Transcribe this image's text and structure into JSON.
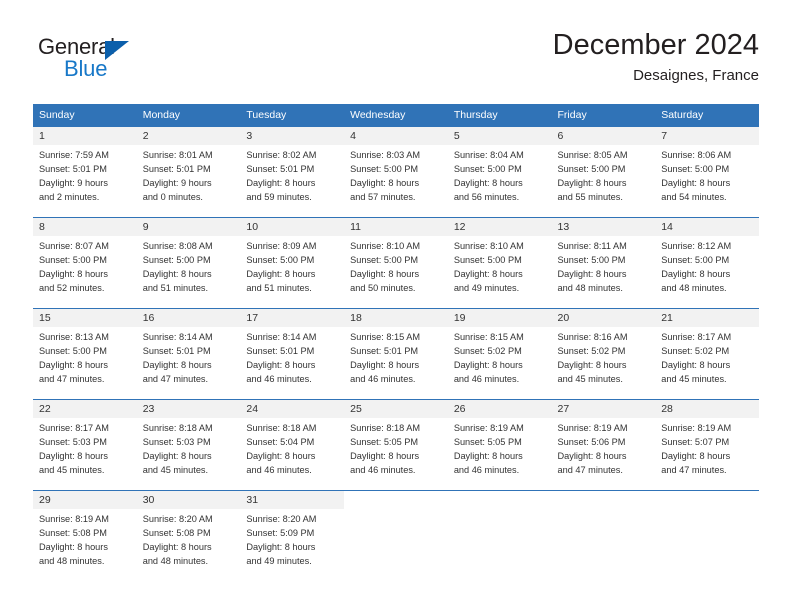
{
  "brand": {
    "name_part1": "General",
    "name_part2": "Blue",
    "accent_color": "#1878c8",
    "triangle_color": "#0b5fab"
  },
  "header": {
    "title": "December 2024",
    "subtitle": "Desaignes, France"
  },
  "calendar": {
    "header_color": "#3073b7",
    "daynum_background": "#f2f2f2",
    "weekday_headers": [
      "Sunday",
      "Monday",
      "Tuesday",
      "Wednesday",
      "Thursday",
      "Friday",
      "Saturday"
    ],
    "weeks": [
      [
        {
          "day": "1",
          "sunrise": "Sunrise: 7:59 AM",
          "sunset": "Sunset: 5:01 PM",
          "daylight_line1": "Daylight: 9 hours",
          "daylight_line2": "and 2 minutes."
        },
        {
          "day": "2",
          "sunrise": "Sunrise: 8:01 AM",
          "sunset": "Sunset: 5:01 PM",
          "daylight_line1": "Daylight: 9 hours",
          "daylight_line2": "and 0 minutes."
        },
        {
          "day": "3",
          "sunrise": "Sunrise: 8:02 AM",
          "sunset": "Sunset: 5:01 PM",
          "daylight_line1": "Daylight: 8 hours",
          "daylight_line2": "and 59 minutes."
        },
        {
          "day": "4",
          "sunrise": "Sunrise: 8:03 AM",
          "sunset": "Sunset: 5:00 PM",
          "daylight_line1": "Daylight: 8 hours",
          "daylight_line2": "and 57 minutes."
        },
        {
          "day": "5",
          "sunrise": "Sunrise: 8:04 AM",
          "sunset": "Sunset: 5:00 PM",
          "daylight_line1": "Daylight: 8 hours",
          "daylight_line2": "and 56 minutes."
        },
        {
          "day": "6",
          "sunrise": "Sunrise: 8:05 AM",
          "sunset": "Sunset: 5:00 PM",
          "daylight_line1": "Daylight: 8 hours",
          "daylight_line2": "and 55 minutes."
        },
        {
          "day": "7",
          "sunrise": "Sunrise: 8:06 AM",
          "sunset": "Sunset: 5:00 PM",
          "daylight_line1": "Daylight: 8 hours",
          "daylight_line2": "and 54 minutes."
        }
      ],
      [
        {
          "day": "8",
          "sunrise": "Sunrise: 8:07 AM",
          "sunset": "Sunset: 5:00 PM",
          "daylight_line1": "Daylight: 8 hours",
          "daylight_line2": "and 52 minutes."
        },
        {
          "day": "9",
          "sunrise": "Sunrise: 8:08 AM",
          "sunset": "Sunset: 5:00 PM",
          "daylight_line1": "Daylight: 8 hours",
          "daylight_line2": "and 51 minutes."
        },
        {
          "day": "10",
          "sunrise": "Sunrise: 8:09 AM",
          "sunset": "Sunset: 5:00 PM",
          "daylight_line1": "Daylight: 8 hours",
          "daylight_line2": "and 51 minutes."
        },
        {
          "day": "11",
          "sunrise": "Sunrise: 8:10 AM",
          "sunset": "Sunset: 5:00 PM",
          "daylight_line1": "Daylight: 8 hours",
          "daylight_line2": "and 50 minutes."
        },
        {
          "day": "12",
          "sunrise": "Sunrise: 8:10 AM",
          "sunset": "Sunset: 5:00 PM",
          "daylight_line1": "Daylight: 8 hours",
          "daylight_line2": "and 49 minutes."
        },
        {
          "day": "13",
          "sunrise": "Sunrise: 8:11 AM",
          "sunset": "Sunset: 5:00 PM",
          "daylight_line1": "Daylight: 8 hours",
          "daylight_line2": "and 48 minutes."
        },
        {
          "day": "14",
          "sunrise": "Sunrise: 8:12 AM",
          "sunset": "Sunset: 5:00 PM",
          "daylight_line1": "Daylight: 8 hours",
          "daylight_line2": "and 48 minutes."
        }
      ],
      [
        {
          "day": "15",
          "sunrise": "Sunrise: 8:13 AM",
          "sunset": "Sunset: 5:00 PM",
          "daylight_line1": "Daylight: 8 hours",
          "daylight_line2": "and 47 minutes."
        },
        {
          "day": "16",
          "sunrise": "Sunrise: 8:14 AM",
          "sunset": "Sunset: 5:01 PM",
          "daylight_line1": "Daylight: 8 hours",
          "daylight_line2": "and 47 minutes."
        },
        {
          "day": "17",
          "sunrise": "Sunrise: 8:14 AM",
          "sunset": "Sunset: 5:01 PM",
          "daylight_line1": "Daylight: 8 hours",
          "daylight_line2": "and 46 minutes."
        },
        {
          "day": "18",
          "sunrise": "Sunrise: 8:15 AM",
          "sunset": "Sunset: 5:01 PM",
          "daylight_line1": "Daylight: 8 hours",
          "daylight_line2": "and 46 minutes."
        },
        {
          "day": "19",
          "sunrise": "Sunrise: 8:15 AM",
          "sunset": "Sunset: 5:02 PM",
          "daylight_line1": "Daylight: 8 hours",
          "daylight_line2": "and 46 minutes."
        },
        {
          "day": "20",
          "sunrise": "Sunrise: 8:16 AM",
          "sunset": "Sunset: 5:02 PM",
          "daylight_line1": "Daylight: 8 hours",
          "daylight_line2": "and 45 minutes."
        },
        {
          "day": "21",
          "sunrise": "Sunrise: 8:17 AM",
          "sunset": "Sunset: 5:02 PM",
          "daylight_line1": "Daylight: 8 hours",
          "daylight_line2": "and 45 minutes."
        }
      ],
      [
        {
          "day": "22",
          "sunrise": "Sunrise: 8:17 AM",
          "sunset": "Sunset: 5:03 PM",
          "daylight_line1": "Daylight: 8 hours",
          "daylight_line2": "and 45 minutes."
        },
        {
          "day": "23",
          "sunrise": "Sunrise: 8:18 AM",
          "sunset": "Sunset: 5:03 PM",
          "daylight_line1": "Daylight: 8 hours",
          "daylight_line2": "and 45 minutes."
        },
        {
          "day": "24",
          "sunrise": "Sunrise: 8:18 AM",
          "sunset": "Sunset: 5:04 PM",
          "daylight_line1": "Daylight: 8 hours",
          "daylight_line2": "and 46 minutes."
        },
        {
          "day": "25",
          "sunrise": "Sunrise: 8:18 AM",
          "sunset": "Sunset: 5:05 PM",
          "daylight_line1": "Daylight: 8 hours",
          "daylight_line2": "and 46 minutes."
        },
        {
          "day": "26",
          "sunrise": "Sunrise: 8:19 AM",
          "sunset": "Sunset: 5:05 PM",
          "daylight_line1": "Daylight: 8 hours",
          "daylight_line2": "and 46 minutes."
        },
        {
          "day": "27",
          "sunrise": "Sunrise: 8:19 AM",
          "sunset": "Sunset: 5:06 PM",
          "daylight_line1": "Daylight: 8 hours",
          "daylight_line2": "and 47 minutes."
        },
        {
          "day": "28",
          "sunrise": "Sunrise: 8:19 AM",
          "sunset": "Sunset: 5:07 PM",
          "daylight_line1": "Daylight: 8 hours",
          "daylight_line2": "and 47 minutes."
        }
      ],
      [
        {
          "day": "29",
          "sunrise": "Sunrise: 8:19 AM",
          "sunset": "Sunset: 5:08 PM",
          "daylight_line1": "Daylight: 8 hours",
          "daylight_line2": "and 48 minutes."
        },
        {
          "day": "30",
          "sunrise": "Sunrise: 8:20 AM",
          "sunset": "Sunset: 5:08 PM",
          "daylight_line1": "Daylight: 8 hours",
          "daylight_line2": "and 48 minutes."
        },
        {
          "day": "31",
          "sunrise": "Sunrise: 8:20 AM",
          "sunset": "Sunset: 5:09 PM",
          "daylight_line1": "Daylight: 8 hours",
          "daylight_line2": "and 49 minutes."
        },
        {
          "day": "",
          "sunrise": "",
          "sunset": "",
          "daylight_line1": "",
          "daylight_line2": ""
        },
        {
          "day": "",
          "sunrise": "",
          "sunset": "",
          "daylight_line1": "",
          "daylight_line2": ""
        },
        {
          "day": "",
          "sunrise": "",
          "sunset": "",
          "daylight_line1": "",
          "daylight_line2": ""
        },
        {
          "day": "",
          "sunrise": "",
          "sunset": "",
          "daylight_line1": "",
          "daylight_line2": ""
        }
      ]
    ]
  }
}
